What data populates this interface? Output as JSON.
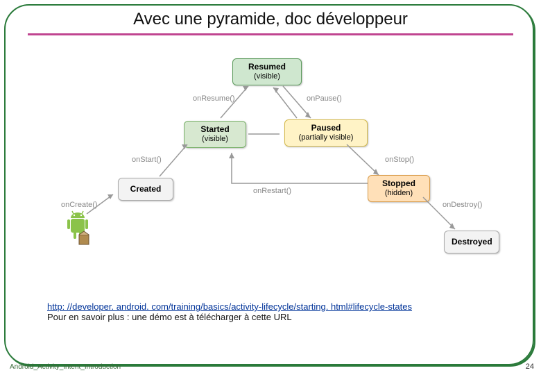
{
  "title": "Avec une pyramide, doc développeur",
  "states": {
    "resumed": {
      "name": "Resumed",
      "sub": "(visible)"
    },
    "started": {
      "name": "Started",
      "sub": "(visible)"
    },
    "paused": {
      "name": "Paused",
      "sub": "(partially visible)"
    },
    "created": {
      "name": "Created",
      "sub": ""
    },
    "stopped": {
      "name": "Stopped",
      "sub": "(hidden)"
    },
    "destroyed": {
      "name": "Destroyed",
      "sub": ""
    }
  },
  "callbacks": {
    "onResume": "onResume()",
    "onPause": "onPause()",
    "onStart": "onStart()",
    "onStop": "onStop()",
    "onCreate": "onCreate()",
    "onRestart": "onRestart()",
    "onDestroy": "onDestroy()"
  },
  "link": {
    "url_text": "http: //developer. android. com/training/basics/activity-lifecycle/starting. html#lifecycle-states",
    "caption": "Pour en savoir plus : une démo est à télécharger à cette URL"
  },
  "footer": "Android_Activity_Intent_Introduction",
  "page_number": "24"
}
